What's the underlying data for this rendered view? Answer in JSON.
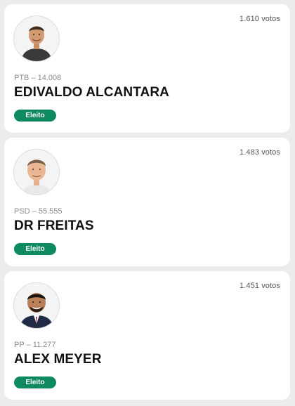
{
  "candidates": [
    {
      "votes": "1.610 votos",
      "party_number": "PTB – 14.008",
      "name": "EDIVALDO ALCANTARA",
      "status": "Eleito"
    },
    {
      "votes": "1.483 votos",
      "party_number": "PSD – 55.555",
      "name": "DR FREITAS",
      "status": "Eleito"
    },
    {
      "votes": "1.451 votos",
      "party_number": "PP – 11.277",
      "name": "ALEX MEYER",
      "status": "Eleito"
    }
  ],
  "colors": {
    "badge": "#0f8a5f",
    "background": "#ececec",
    "card": "#ffffff"
  }
}
